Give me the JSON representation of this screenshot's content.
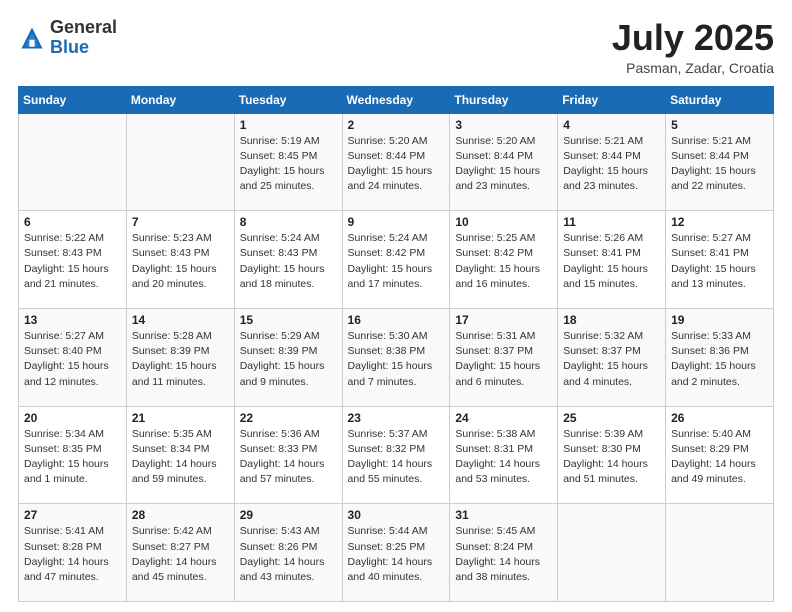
{
  "header": {
    "logo_general": "General",
    "logo_blue": "Blue",
    "month_year": "July 2025",
    "location": "Pasman, Zadar, Croatia"
  },
  "days_of_week": [
    "Sunday",
    "Monday",
    "Tuesday",
    "Wednesday",
    "Thursday",
    "Friday",
    "Saturday"
  ],
  "weeks": [
    [
      {
        "day": "",
        "info": ""
      },
      {
        "day": "",
        "info": ""
      },
      {
        "day": "1",
        "info": "Sunrise: 5:19 AM\nSunset: 8:45 PM\nDaylight: 15 hours\nand 25 minutes."
      },
      {
        "day": "2",
        "info": "Sunrise: 5:20 AM\nSunset: 8:44 PM\nDaylight: 15 hours\nand 24 minutes."
      },
      {
        "day": "3",
        "info": "Sunrise: 5:20 AM\nSunset: 8:44 PM\nDaylight: 15 hours\nand 23 minutes."
      },
      {
        "day": "4",
        "info": "Sunrise: 5:21 AM\nSunset: 8:44 PM\nDaylight: 15 hours\nand 23 minutes."
      },
      {
        "day": "5",
        "info": "Sunrise: 5:21 AM\nSunset: 8:44 PM\nDaylight: 15 hours\nand 22 minutes."
      }
    ],
    [
      {
        "day": "6",
        "info": "Sunrise: 5:22 AM\nSunset: 8:43 PM\nDaylight: 15 hours\nand 21 minutes."
      },
      {
        "day": "7",
        "info": "Sunrise: 5:23 AM\nSunset: 8:43 PM\nDaylight: 15 hours\nand 20 minutes."
      },
      {
        "day": "8",
        "info": "Sunrise: 5:24 AM\nSunset: 8:43 PM\nDaylight: 15 hours\nand 18 minutes."
      },
      {
        "day": "9",
        "info": "Sunrise: 5:24 AM\nSunset: 8:42 PM\nDaylight: 15 hours\nand 17 minutes."
      },
      {
        "day": "10",
        "info": "Sunrise: 5:25 AM\nSunset: 8:42 PM\nDaylight: 15 hours\nand 16 minutes."
      },
      {
        "day": "11",
        "info": "Sunrise: 5:26 AM\nSunset: 8:41 PM\nDaylight: 15 hours\nand 15 minutes."
      },
      {
        "day": "12",
        "info": "Sunrise: 5:27 AM\nSunset: 8:41 PM\nDaylight: 15 hours\nand 13 minutes."
      }
    ],
    [
      {
        "day": "13",
        "info": "Sunrise: 5:27 AM\nSunset: 8:40 PM\nDaylight: 15 hours\nand 12 minutes."
      },
      {
        "day": "14",
        "info": "Sunrise: 5:28 AM\nSunset: 8:39 PM\nDaylight: 15 hours\nand 11 minutes."
      },
      {
        "day": "15",
        "info": "Sunrise: 5:29 AM\nSunset: 8:39 PM\nDaylight: 15 hours\nand 9 minutes."
      },
      {
        "day": "16",
        "info": "Sunrise: 5:30 AM\nSunset: 8:38 PM\nDaylight: 15 hours\nand 7 minutes."
      },
      {
        "day": "17",
        "info": "Sunrise: 5:31 AM\nSunset: 8:37 PM\nDaylight: 15 hours\nand 6 minutes."
      },
      {
        "day": "18",
        "info": "Sunrise: 5:32 AM\nSunset: 8:37 PM\nDaylight: 15 hours\nand 4 minutes."
      },
      {
        "day": "19",
        "info": "Sunrise: 5:33 AM\nSunset: 8:36 PM\nDaylight: 15 hours\nand 2 minutes."
      }
    ],
    [
      {
        "day": "20",
        "info": "Sunrise: 5:34 AM\nSunset: 8:35 PM\nDaylight: 15 hours\nand 1 minute."
      },
      {
        "day": "21",
        "info": "Sunrise: 5:35 AM\nSunset: 8:34 PM\nDaylight: 14 hours\nand 59 minutes."
      },
      {
        "day": "22",
        "info": "Sunrise: 5:36 AM\nSunset: 8:33 PM\nDaylight: 14 hours\nand 57 minutes."
      },
      {
        "day": "23",
        "info": "Sunrise: 5:37 AM\nSunset: 8:32 PM\nDaylight: 14 hours\nand 55 minutes."
      },
      {
        "day": "24",
        "info": "Sunrise: 5:38 AM\nSunset: 8:31 PM\nDaylight: 14 hours\nand 53 minutes."
      },
      {
        "day": "25",
        "info": "Sunrise: 5:39 AM\nSunset: 8:30 PM\nDaylight: 14 hours\nand 51 minutes."
      },
      {
        "day": "26",
        "info": "Sunrise: 5:40 AM\nSunset: 8:29 PM\nDaylight: 14 hours\nand 49 minutes."
      }
    ],
    [
      {
        "day": "27",
        "info": "Sunrise: 5:41 AM\nSunset: 8:28 PM\nDaylight: 14 hours\nand 47 minutes."
      },
      {
        "day": "28",
        "info": "Sunrise: 5:42 AM\nSunset: 8:27 PM\nDaylight: 14 hours\nand 45 minutes."
      },
      {
        "day": "29",
        "info": "Sunrise: 5:43 AM\nSunset: 8:26 PM\nDaylight: 14 hours\nand 43 minutes."
      },
      {
        "day": "30",
        "info": "Sunrise: 5:44 AM\nSunset: 8:25 PM\nDaylight: 14 hours\nand 40 minutes."
      },
      {
        "day": "31",
        "info": "Sunrise: 5:45 AM\nSunset: 8:24 PM\nDaylight: 14 hours\nand 38 minutes."
      },
      {
        "day": "",
        "info": ""
      },
      {
        "day": "",
        "info": ""
      }
    ]
  ]
}
